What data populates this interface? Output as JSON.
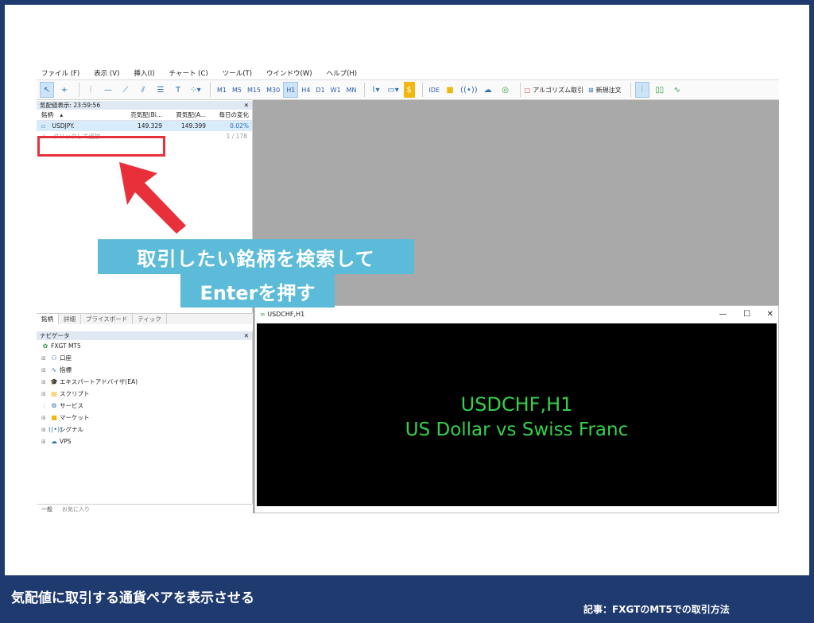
{
  "menu": [
    "ファイル (F)",
    "表示 (V)",
    "挿入(I)",
    "チャート (C)",
    "ツール(T)",
    "ウインドウ(W)",
    "ヘルプ(H)"
  ],
  "toolbar": {
    "timeframes": [
      "M1",
      "M5",
      "M15",
      "M30",
      "H1",
      "H4",
      "D1",
      "W1",
      "MN"
    ],
    "active_timeframe": "H1",
    "ide_label": "IDE",
    "algo_label": "アルゴリズム取引",
    "new_order_label": "新規注文"
  },
  "market_watch": {
    "title": "気配値表示: 23:59:56",
    "columns": [
      "銘柄",
      "売気配(Bi...",
      "買気配(A...",
      "毎日の変化"
    ],
    "rows": [
      {
        "symbol": "USDJPY.",
        "bid": "149.329",
        "ask": "149.399",
        "change": "0.02%"
      }
    ],
    "add_placeholder": "クリックして追加...",
    "count": "1 / 178",
    "tabs": [
      "銘柄",
      "詳細",
      "プライスボード",
      "ティック"
    ]
  },
  "navigator": {
    "title": "ナビゲータ",
    "root": "FXGT MT5",
    "items": [
      "口座",
      "指標",
      "エキスパートアドバイザ(EA)",
      "スクリプト",
      "サービス",
      "マーケット",
      "シグナル",
      "VPS"
    ],
    "bottom_tabs": [
      "一般",
      "お気に入り"
    ]
  },
  "chart_window": {
    "title": "USDCHF,H1",
    "line1": "USDCHF,H1",
    "line2": "US Dollar vs Swiss Franc"
  },
  "callout": {
    "line1": "取引したい銘柄を検索して",
    "line2": "Enterを押す"
  },
  "footer": {
    "caption": "気配値に取引する通貨ペアを表示させる",
    "article": "記事：FXGTのMT5での取引方法"
  },
  "colors": {
    "frame": "#1f3a6e",
    "callout": "#5bbbd8",
    "highlight": "#e8303a",
    "chart_text": "#35d04a"
  }
}
